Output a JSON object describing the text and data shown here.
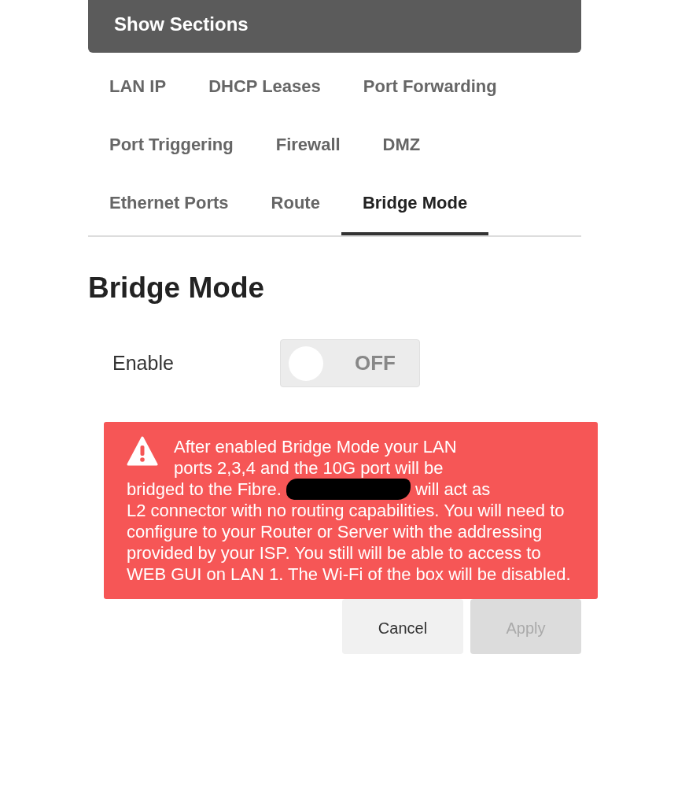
{
  "header": {
    "title": "Show Sections"
  },
  "tabs": [
    {
      "label": "LAN IP",
      "selected": false
    },
    {
      "label": "DHCP Leases",
      "selected": false
    },
    {
      "label": "Port Forwarding",
      "selected": false
    },
    {
      "label": "Port Triggering",
      "selected": false
    },
    {
      "label": "Firewall",
      "selected": false
    },
    {
      "label": "DMZ",
      "selected": false
    },
    {
      "label": "Ethernet Ports",
      "selected": false
    },
    {
      "label": "Route",
      "selected": false
    },
    {
      "label": "Bridge Mode",
      "selected": true
    }
  ],
  "section": {
    "title": "Bridge Mode",
    "enable": {
      "label": "Enable",
      "on": false,
      "state_label": "OFF"
    },
    "warning": {
      "text_before": "After enabled Bridge Mode your LAN ports 2,3,4 and the 10G port will be",
      "text_line": "bridged to the Fibre.",
      "redacted": true,
      "text_after": "will act as",
      "text_rest": "L2 connector with no routing capabilities. You will need to configure to your Router or Server with the addressing provided by your ISP. You still will be able to access to WEB GUI on LAN 1. The Wi-Fi of the box will be disabled."
    },
    "buttons": [
      {
        "label": "Cancel",
        "disabled": false
      },
      {
        "label": "Apply",
        "disabled": true
      }
    ]
  }
}
